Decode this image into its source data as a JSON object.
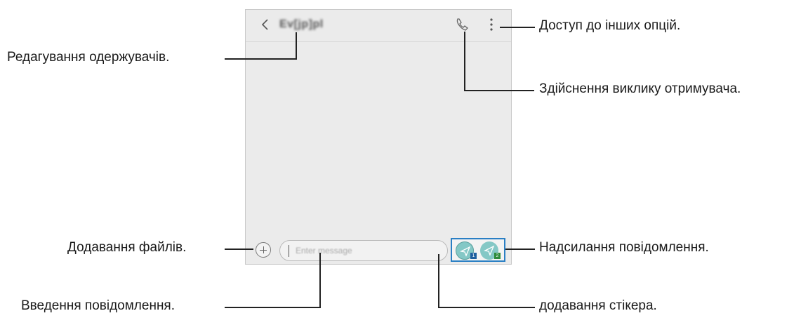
{
  "phone": {
    "contact_name": "Ev[jp]pl",
    "input_placeholder": "Enter message",
    "sim1": "1",
    "sim2": "2",
    "icons": {
      "back": "back-arrow-icon",
      "call": "phone-icon",
      "more": "more-options-icon",
      "attach": "plus-icon",
      "sticker": "sticker-icon",
      "send": "send-icon"
    }
  },
  "callouts": {
    "more_options": "Доступ до інших опцій.",
    "edit_recipients": "Редагування одержувачів.",
    "call_recipient": "Здійснення виклику отримувача.",
    "attach_files": "Додавання файлів.",
    "send_message": "Надсилання повідомлення.",
    "enter_message": "Введення повідомлення.",
    "add_sticker": "додавання стікера."
  },
  "colors": {
    "send_button": "#84c8c6",
    "send_group_border": "#2a7fc4",
    "screen_bg": "#ebebeb"
  }
}
